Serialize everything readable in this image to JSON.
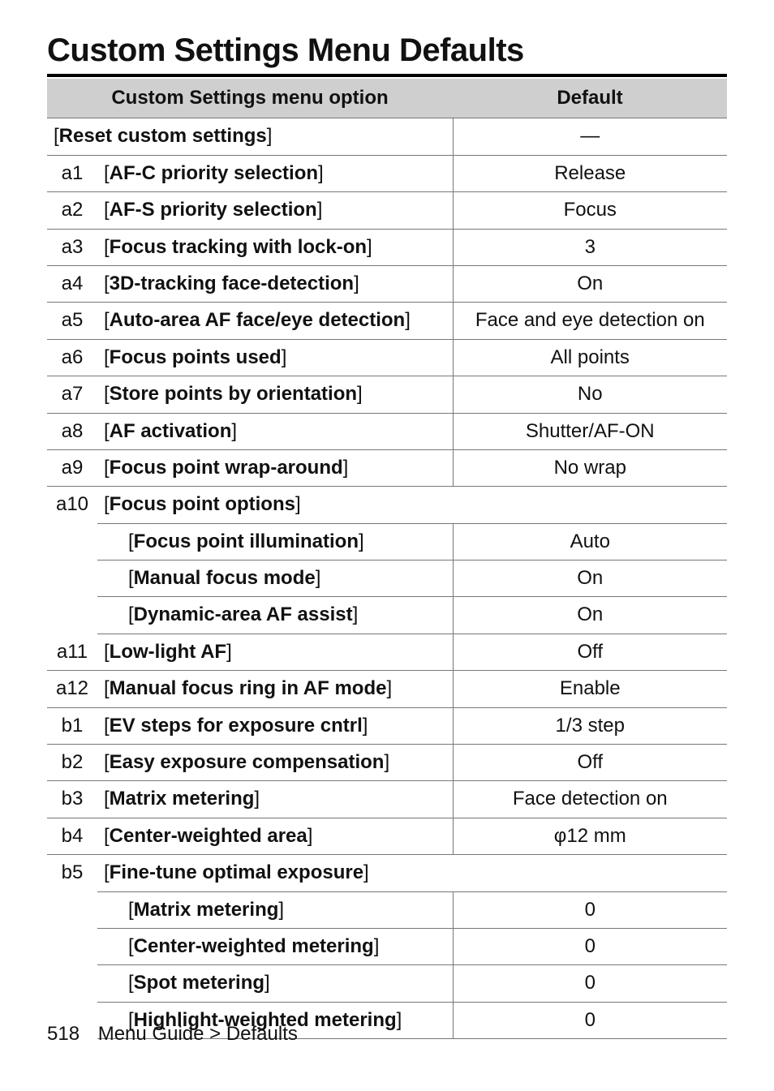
{
  "title": "Custom Settings Menu Defaults",
  "table": {
    "header_option": "Custom Settings menu option",
    "header_default": "Default",
    "reset_label": "[Reset custom settings]",
    "reset_default": "—",
    "rows": [
      {
        "num": "a1",
        "label": "[AF-C priority selection]",
        "default": "Release"
      },
      {
        "num": "a2",
        "label": "[AF-S priority selection]",
        "default": "Focus"
      },
      {
        "num": "a3",
        "label": "[Focus tracking with lock-on]",
        "default": "3"
      },
      {
        "num": "a4",
        "label": "[3D-tracking face-detection]",
        "default": "On"
      },
      {
        "num": "a5",
        "label": "[Auto-area AF face/eye detection]",
        "default": "Face and eye detection on"
      },
      {
        "num": "a6",
        "label": "[Focus points used]",
        "default": "All points"
      },
      {
        "num": "a7",
        "label": "[Store points by orientation]",
        "default": "No"
      },
      {
        "num": "a8",
        "label": "[AF activation]",
        "default": "Shutter/AF-ON"
      },
      {
        "num": "a9",
        "label": "[Focus point wrap-around]",
        "default": "No wrap"
      }
    ],
    "a10": {
      "num": "a10",
      "label": "[Focus point options]",
      "subs": [
        {
          "label": "[Focus point illumination]",
          "default": "Auto"
        },
        {
          "label": "[Manual focus mode]",
          "default": "On"
        },
        {
          "label": "[Dynamic-area AF assist]",
          "default": "On"
        }
      ]
    },
    "rows2": [
      {
        "num": "a11",
        "label": "[Low-light AF]",
        "default": "Off"
      },
      {
        "num": "a12",
        "label": "[Manual focus ring in AF mode]",
        "default": "Enable"
      },
      {
        "num": "b1",
        "label": "[EV steps for exposure cntrl]",
        "default": "1/3 step"
      },
      {
        "num": "b2",
        "label": "[Easy exposure compensation]",
        "default": "Off"
      },
      {
        "num": "b3",
        "label": "[Matrix metering]",
        "default": "Face detection on"
      },
      {
        "num": "b4",
        "label": "[Center-weighted area]",
        "default": "φ12 mm"
      }
    ],
    "b5": {
      "num": "b5",
      "label": "[Fine-tune optimal exposure]",
      "subs": [
        {
          "label": "[Matrix metering]",
          "default": "0"
        },
        {
          "label": "[Center-weighted metering]",
          "default": "0"
        },
        {
          "label": "[Spot metering]",
          "default": "0"
        },
        {
          "label": "[Highlight-weighted metering]",
          "default": "0"
        }
      ]
    }
  },
  "footer": {
    "page_number": "518",
    "breadcrumb": "Menu Guide > Defaults"
  }
}
